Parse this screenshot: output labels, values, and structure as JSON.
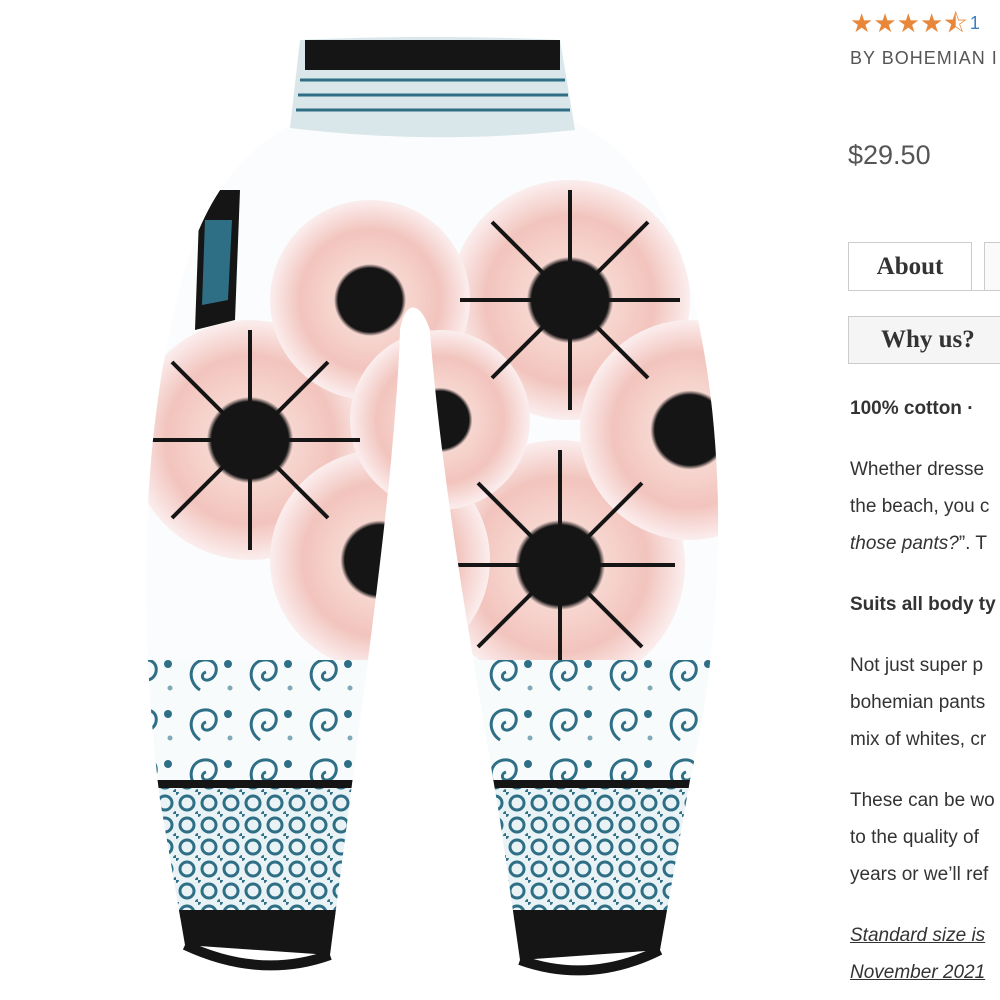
{
  "product": {
    "rating_stars": 4.5,
    "review_count_partial": "1",
    "brand_text": "BY BOHEMIAN I",
    "price": "$29.50",
    "image_alt": "harem pants with black, pink and teal mandala pattern",
    "colors": {
      "accent_star": "#e8873a",
      "pattern_black": "#151515",
      "pattern_pink": "#f2c4bd",
      "pattern_teal": "#2e6f86"
    }
  },
  "tabs": {
    "about": "About",
    "why_us": "Why us?"
  },
  "description": {
    "line1_bold": "100% cotton  ·",
    "line2": "Whether dresse",
    "line3": "the beach, you c",
    "line4_italic": "those pants?",
    "line4_rest": "”. T",
    "line5_bold": "Suits all body ty",
    "line6": "Not just super p",
    "line7": "bohemian pants",
    "line8": "mix of whites, cr",
    "line9": "These can be wo",
    "line10": "to the quality of",
    "line11": "years or we’ll ref",
    "line12_underline": "Standard size is",
    "line13_underline": "November 2021"
  }
}
